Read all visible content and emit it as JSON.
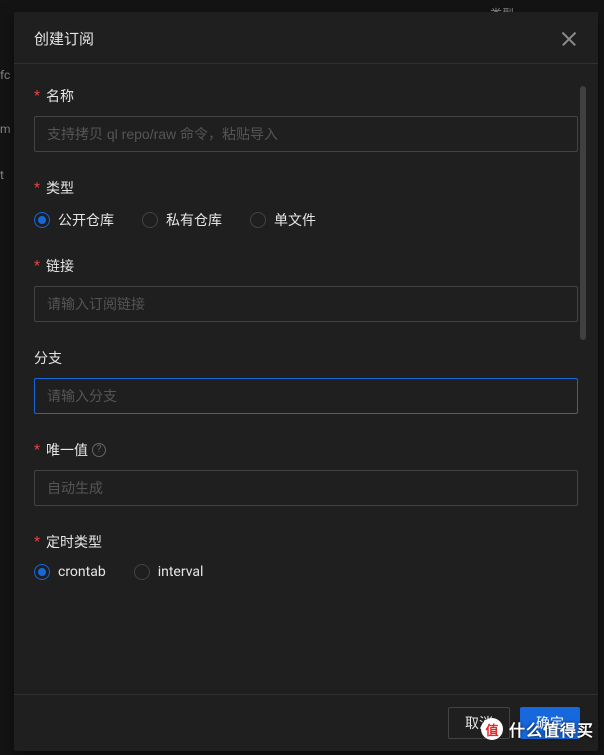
{
  "backdrop": {
    "text1": "类型",
    "text2": "fc",
    "text3": "m",
    "text4": "t"
  },
  "modal": {
    "title": "创建订阅",
    "footer": {
      "cancel": "取消",
      "confirm": "确定"
    }
  },
  "form": {
    "name": {
      "label": "名称",
      "placeholder": "支持拷贝 ql repo/raw 命令，粘贴导入"
    },
    "type": {
      "label": "类型",
      "options": [
        "公开仓库",
        "私有仓库",
        "单文件"
      ],
      "selected": 0
    },
    "link": {
      "label": "链接",
      "placeholder": "请输入订阅链接"
    },
    "branch": {
      "label": "分支",
      "placeholder": "请输入分支"
    },
    "uniqueValue": {
      "label": "唯一值",
      "placeholder": "自动生成"
    },
    "scheduleType": {
      "label": "定时类型",
      "options": [
        "crontab",
        "interval"
      ],
      "selected": 0
    }
  },
  "watermark": {
    "logo": "值",
    "text": "什么值得买"
  }
}
